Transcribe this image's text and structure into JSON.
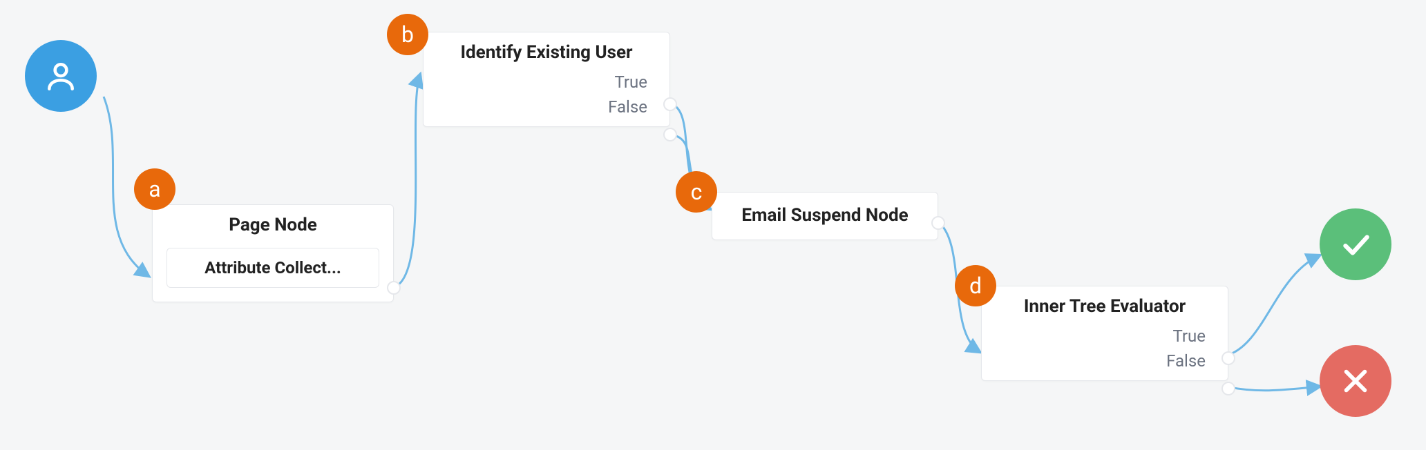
{
  "badges": {
    "a": "a",
    "b": "b",
    "c": "c",
    "d": "d"
  },
  "nodes": {
    "page_node": {
      "title": "Page Node",
      "inner": "Attribute Collect..."
    },
    "identify": {
      "title": "Identify Existing User",
      "outputs": [
        "True",
        "False"
      ]
    },
    "email_suspend": {
      "title": "Email Suspend Node"
    },
    "inner_tree": {
      "title": "Inner Tree Evaluator",
      "outputs": [
        "True",
        "False"
      ]
    }
  }
}
